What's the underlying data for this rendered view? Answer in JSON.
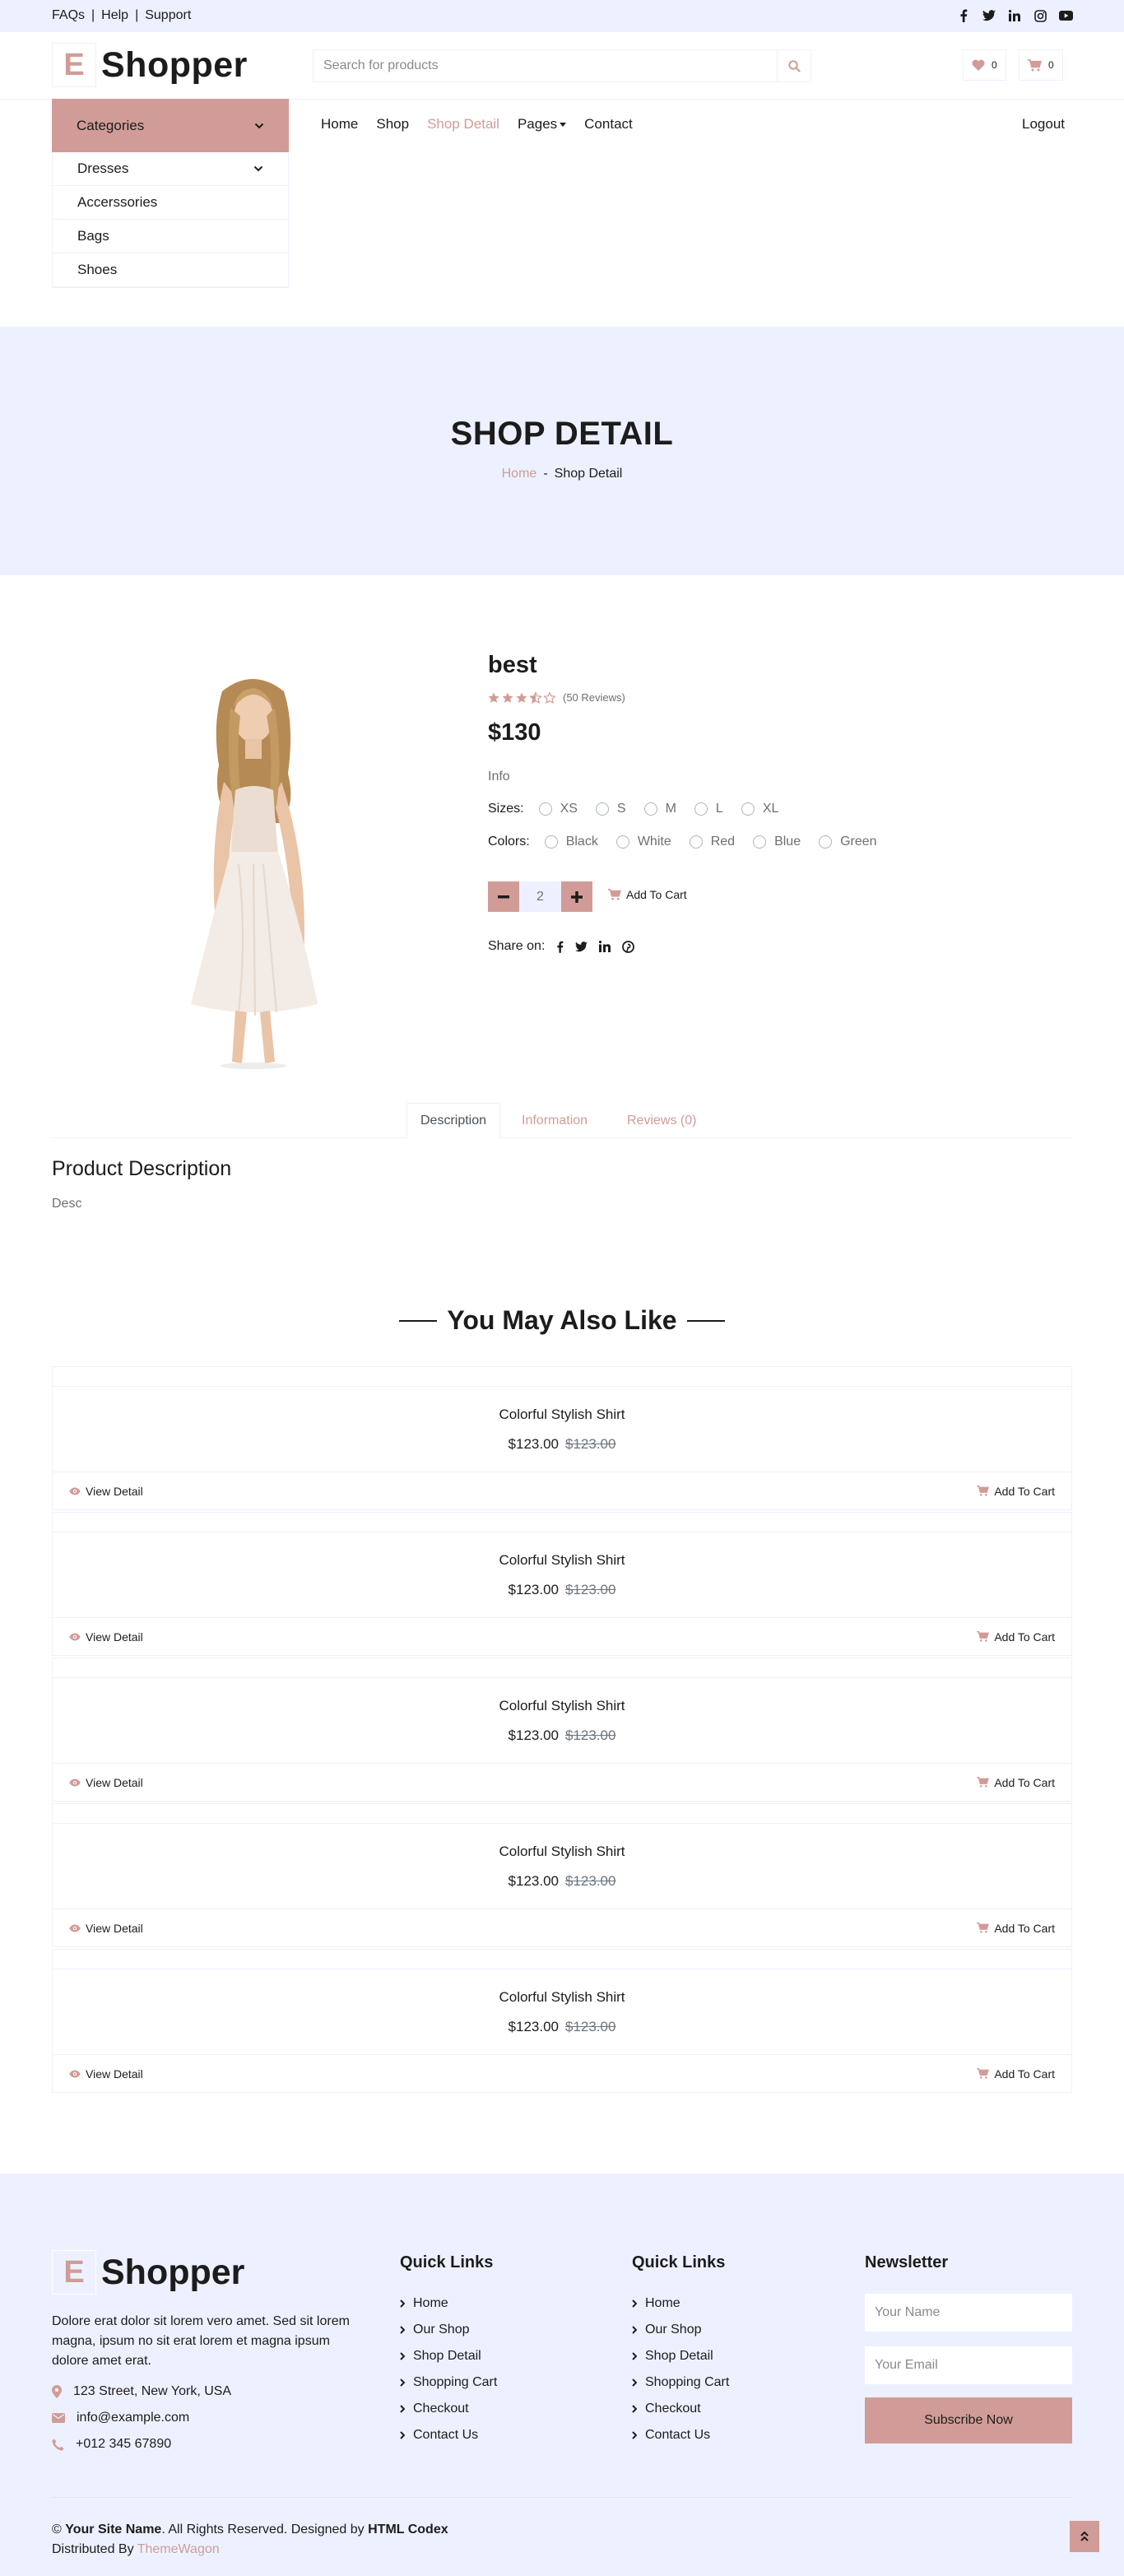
{
  "topbar": {
    "links": [
      "FAQs",
      "Help",
      "Support"
    ],
    "social_icons": [
      "facebook-icon",
      "twitter-icon",
      "linkedin-icon",
      "instagram-icon",
      "youtube-icon"
    ]
  },
  "header": {
    "logo_letter": "E",
    "brand": "Shopper",
    "search_placeholder": "Search for products",
    "wishlist_count": "0",
    "cart_count": "0"
  },
  "categories": {
    "title": "Categories",
    "items": [
      "Dresses",
      "Accerssories",
      "Bags",
      "Shoes"
    ]
  },
  "nav": {
    "items": [
      "Home",
      "Shop",
      "Shop Detail",
      "Pages",
      "Contact"
    ],
    "active": "Shop Detail",
    "logout": "Logout"
  },
  "page_header": {
    "title": "SHOP DETAIL",
    "crumb_home": "Home",
    "crumb_sep": "-",
    "crumb_current": "Shop Detail"
  },
  "product": {
    "name": "best",
    "rating": 3.5,
    "reviews": "(50 Reviews)",
    "price": "$130",
    "info": "Info",
    "sizes_label": "Sizes:",
    "sizes": [
      "XS",
      "S",
      "M",
      "L",
      "XL"
    ],
    "colors_label": "Colors:",
    "colors": [
      "Black",
      "White",
      "Red",
      "Blue",
      "Green"
    ],
    "quantity": "2",
    "add_to_cart": "Add To Cart",
    "share_label": "Share on:"
  },
  "tabs": {
    "items": [
      "Description",
      "Information",
      "Reviews (0)"
    ],
    "active": "Description",
    "desc_title": "Product Description",
    "desc_text": "Desc"
  },
  "related": {
    "title": "You May Also Like",
    "items": [
      {
        "name": "Colorful Stylish Shirt",
        "price": "$123.00",
        "old_price": "$123.00",
        "view": "View Detail",
        "cart": "Add To Cart"
      },
      {
        "name": "Colorful Stylish Shirt",
        "price": "$123.00",
        "old_price": "$123.00",
        "view": "View Detail",
        "cart": "Add To Cart"
      },
      {
        "name": "Colorful Stylish Shirt",
        "price": "$123.00",
        "old_price": "$123.00",
        "view": "View Detail",
        "cart": "Add To Cart"
      },
      {
        "name": "Colorful Stylish Shirt",
        "price": "$123.00",
        "old_price": "$123.00",
        "view": "View Detail",
        "cart": "Add To Cart"
      },
      {
        "name": "Colorful Stylish Shirt",
        "price": "$123.00",
        "old_price": "$123.00",
        "view": "View Detail",
        "cart": "Add To Cart"
      }
    ]
  },
  "footer": {
    "logo_letter": "E",
    "brand": "Shopper",
    "about": "Dolore erat dolor sit lorem vero amet. Sed sit lorem magna, ipsum no sit erat lorem et magna ipsum dolore amet erat.",
    "address": "123 Street, New York, USA",
    "email": "info@example.com",
    "phone": "+012 345 67890",
    "quick_links_title": "Quick Links",
    "quick_links": [
      "Home",
      "Our Shop",
      "Shop Detail",
      "Shopping Cart",
      "Checkout",
      "Contact Us"
    ],
    "newsletter_title": "Newsletter",
    "name_placeholder": "Your Name",
    "email_placeholder": "Your Email",
    "subscribe": "Subscribe Now",
    "copy_prefix": "©",
    "site_name": "Your Site Name",
    "copy_mid": ". All Rights Reserved. Designed by",
    "designer": "HTML Codex",
    "distributed_by": "Distributed By",
    "distributor": "ThemeWagon"
  },
  "colors": {
    "primary": "#d19c97",
    "secondary": "#edf1ff",
    "dark": "#1c1c1c"
  }
}
